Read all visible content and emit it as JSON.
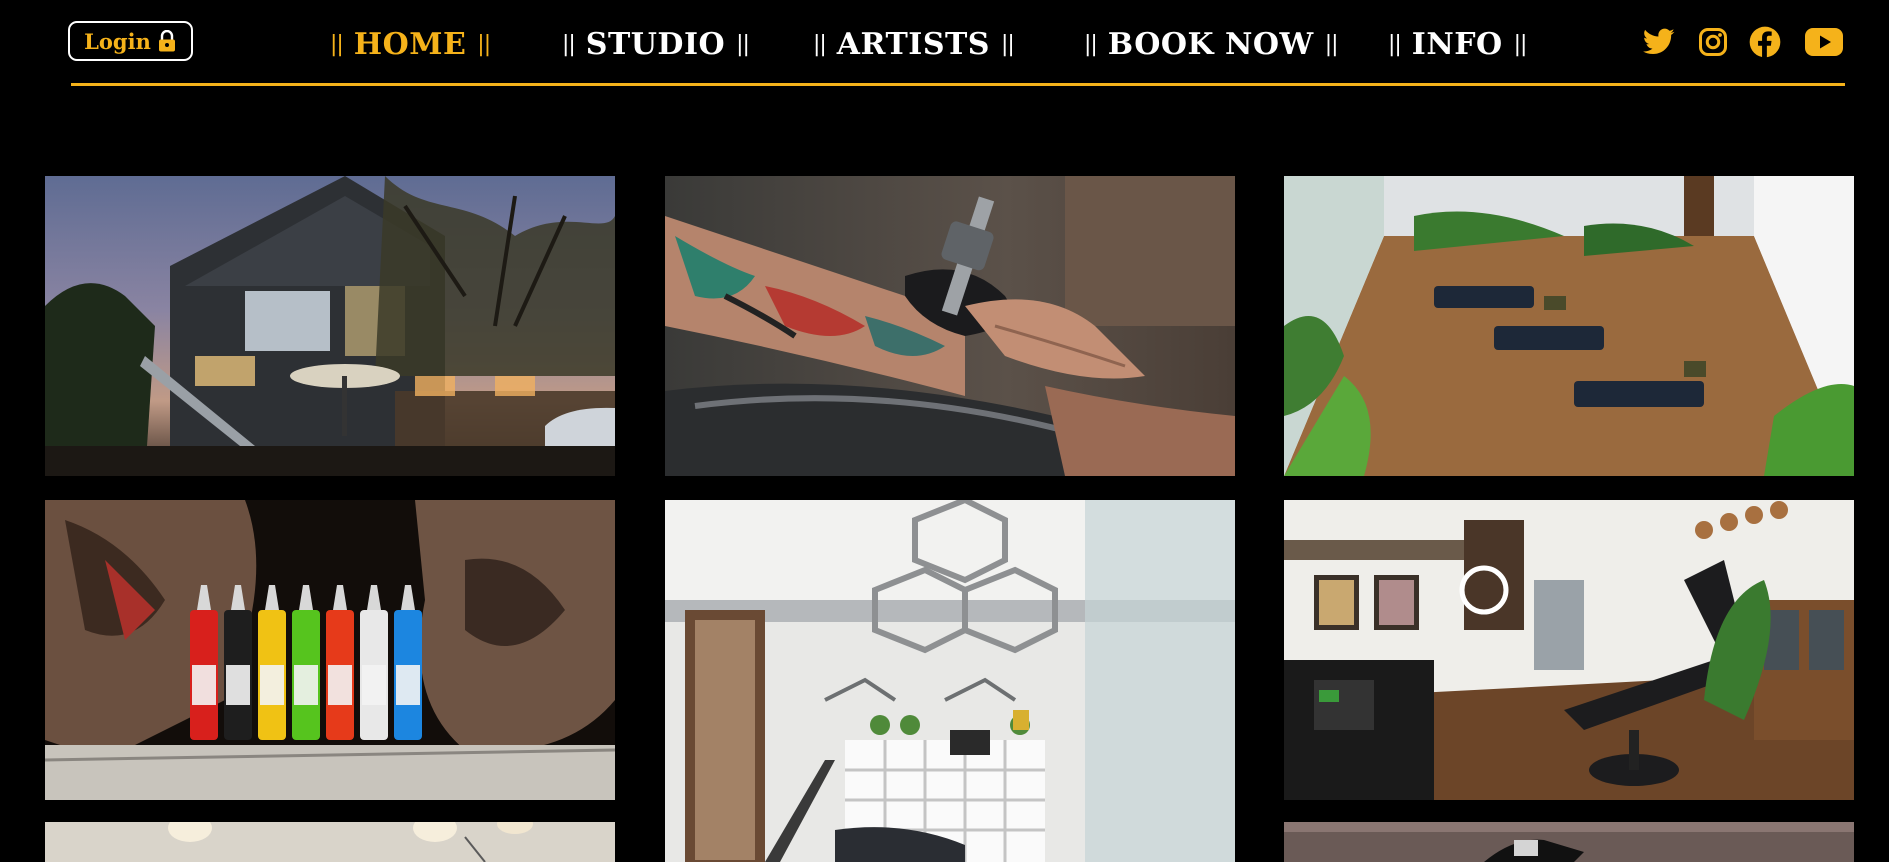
{
  "colors": {
    "accent": "#f5b21a",
    "background": "#000000",
    "text": "#ffffff"
  },
  "header": {
    "login_label": "Login",
    "login_icon": "lock-icon"
  },
  "nav": {
    "items": [
      {
        "label": "HOME",
        "active": true
      },
      {
        "label": "STUDIO",
        "active": false
      },
      {
        "label": "ARTISTS",
        "active": false
      },
      {
        "label": "BOOK NOW",
        "active": false
      },
      {
        "label": "INFO",
        "active": false
      }
    ],
    "separator": "||"
  },
  "social": [
    {
      "name": "twitter-icon"
    },
    {
      "name": "instagram-icon"
    },
    {
      "name": "facebook-icon"
    },
    {
      "name": "youtube-icon"
    }
  ],
  "gallery": {
    "images": [
      {
        "name": "studio-exterior-photo"
      },
      {
        "name": "tattooing-arm-photo"
      },
      {
        "name": "studio-interior-plants-photo"
      },
      {
        "name": "ink-bottles-photo"
      },
      {
        "name": "studio-loft-interior-photo"
      },
      {
        "name": "tattoo-chair-room-photo"
      },
      {
        "name": "lanterns-room-photo"
      },
      {
        "name": "tattoo-machine-photo"
      }
    ]
  }
}
